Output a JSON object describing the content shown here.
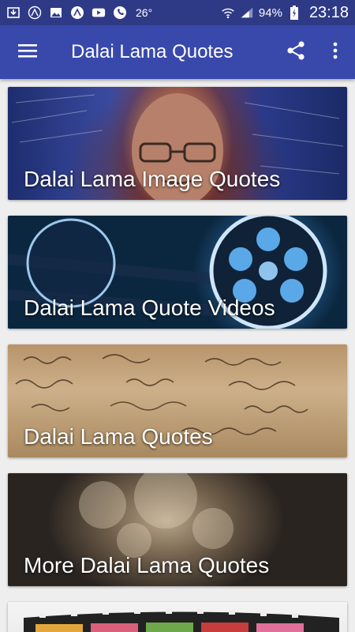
{
  "status_bar": {
    "temperature": "26°",
    "battery": "94%",
    "time": "23:18"
  },
  "app_bar": {
    "title": "Dalai Lama Quotes"
  },
  "cards": [
    {
      "label": "Dalai Lama Image Quotes"
    },
    {
      "label": "Dalai Lama Quote Videos"
    },
    {
      "label": "Dalai Lama Quotes"
    },
    {
      "label": "More Dalai Lama Quotes"
    }
  ],
  "colors": {
    "status_bar": "#2f3a87",
    "app_bar": "#3949ab",
    "background": "#eeeeee"
  }
}
